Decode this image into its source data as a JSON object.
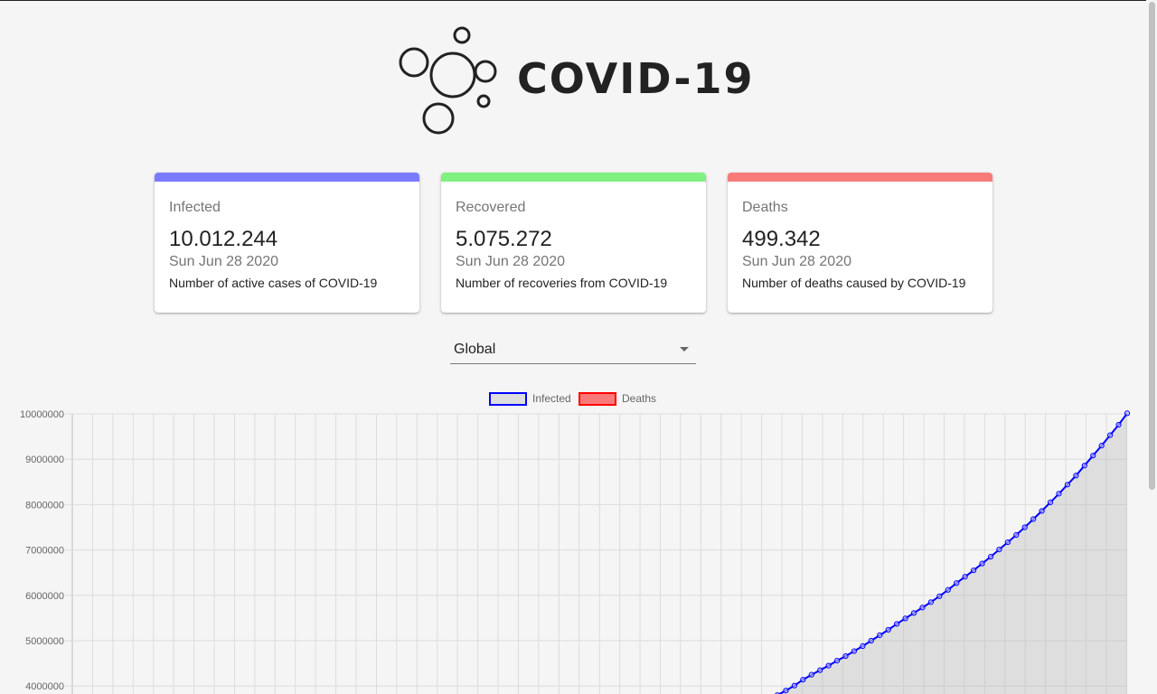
{
  "header": {
    "logo_text": "COVID-19"
  },
  "cards": [
    {
      "title": "Infected",
      "value": "10.012.244",
      "date": "Sun Jun 28 2020",
      "description": "Number of active cases of COVID-19",
      "color": "#7b7bff"
    },
    {
      "title": "Recovered",
      "value": "5.075.272",
      "date": "Sun Jun 28 2020",
      "description": "Number of recoveries from COVID-19",
      "color": "#80f080"
    },
    {
      "title": "Deaths",
      "value": "499.342",
      "date": "Sun Jun 28 2020",
      "description": "Number of deaths caused by COVID-19",
      "color": "#f77b78"
    }
  ],
  "country_select": {
    "value": "Global"
  },
  "chart_data": {
    "type": "line",
    "legend": {
      "position": "top",
      "items": [
        {
          "name": "Infected",
          "border": "#0000ff",
          "fill": "rgba(180,180,180,0.35)"
        },
        {
          "name": "Deaths",
          "border": "#ff0000",
          "fill": "rgba(255,0,0,0.5)"
        }
      ]
    },
    "grid": true,
    "ylim": [
      4000000,
      10000000
    ],
    "ytick_labels": [
      "10000000",
      "9000000",
      "8000000",
      "7000000",
      "6000000",
      "5000000",
      "4000000"
    ],
    "series": [
      {
        "name": "Infected",
        "color": "#0000ff",
        "values_visible_segment": [
          3800000,
          3900000,
          4010000,
          4140000,
          4250000,
          4350000,
          4450000,
          4560000,
          4660000,
          4770000,
          4880000,
          5000000,
          5120000,
          5240000,
          5370000,
          5490000,
          5610000,
          5730000,
          5850000,
          5980000,
          6120000,
          6270000,
          6410000,
          6550000,
          6700000,
          6850000,
          7010000,
          7170000,
          7330000,
          7500000,
          7680000,
          7860000,
          8050000,
          8240000,
          8440000,
          8640000,
          8860000,
          9080000,
          9300000,
          9530000,
          9760000,
          10012244
        ]
      }
    ]
  }
}
